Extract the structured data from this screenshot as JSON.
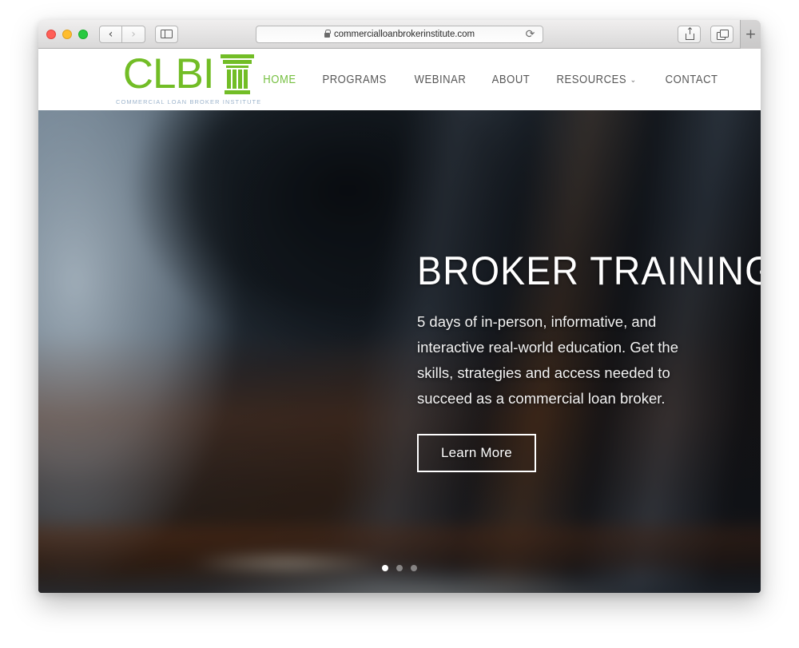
{
  "browser": {
    "window_controls": {
      "close": "close",
      "minimize": "minimize",
      "maximize": "maximize"
    },
    "back_glyph": "‹",
    "forward_glyph": "›",
    "sidebar_icon": "sidebar-icon",
    "url": "commercialloanbrokerinstitute.com",
    "lock_icon": "lock-icon",
    "reload_glyph": "⟳",
    "share_icon": "share-icon",
    "tabs_icon": "tabs-overview-icon",
    "new_tab_glyph": "+"
  },
  "site": {
    "logo": {
      "word": "CLBI",
      "tagline": "COMMERCIAL LOAN BROKER INSTITUTE",
      "column_icon": "column-icon",
      "brand_green": "#72bd26",
      "tagline_color": "#9db4cc"
    },
    "nav": {
      "items": [
        {
          "label": "HOME",
          "active": true,
          "has_dropdown": false
        },
        {
          "label": "PROGRAMS",
          "active": false,
          "has_dropdown": false
        },
        {
          "label": "WEBINAR",
          "active": false,
          "has_dropdown": false
        },
        {
          "label": "ABOUT",
          "active": false,
          "has_dropdown": false
        },
        {
          "label": "RESOURCES",
          "active": false,
          "has_dropdown": true
        },
        {
          "label": "CONTACT",
          "active": false,
          "has_dropdown": false
        }
      ],
      "caret_glyph": "⌄",
      "active_color": "#77c043"
    },
    "hero": {
      "title": "BROKER TRAINING",
      "subtitle": "5 days of in-person, informative, and interactive real-world education. Get the skills, strategies and access needed to succeed as a commercial loan broker.",
      "cta_label": "Learn More",
      "slider": {
        "total": 3,
        "active_index": 0
      }
    }
  }
}
